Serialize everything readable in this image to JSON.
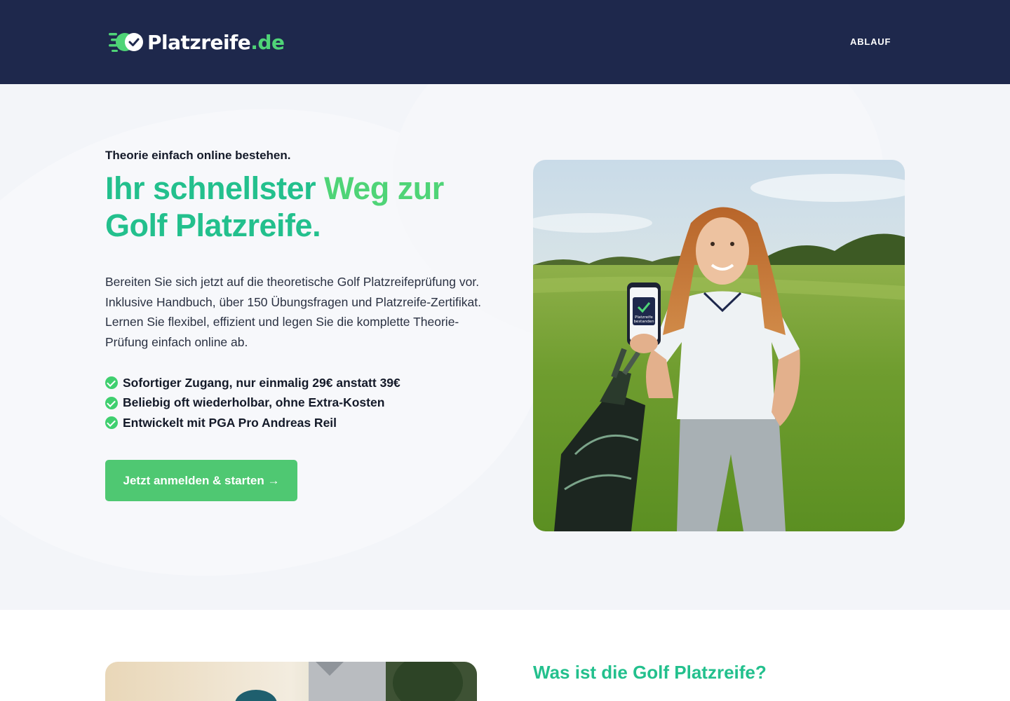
{
  "header": {
    "logo": {
      "name": "Platzreife",
      "tld": ".de"
    },
    "nav": [
      {
        "label": "ABLAUF"
      }
    ]
  },
  "hero": {
    "eyebrow": "Theorie einfach online bestehen.",
    "headline_part1": "Ihr schnellster ",
    "headline_part2": "Weg zur",
    "headline_part3": "Golf Platzreife.",
    "intro": "Bereiten Sie sich jetzt auf die theoretische Golf Platzreifeprüfung vor. Inklusive Handbuch, über 150 Übungsfragen und Platzreife-Zertifikat. Lernen Sie flexibel, effizient und legen Sie die komplette Theorie-Prüfung einfach online ab.",
    "features": [
      "Sofortiger Zugang, nur einmalig 29€ anstatt 39€",
      "Beliebig oft wiederholbar, ohne Extra-Kosten",
      "Entwickelt mit PGA Pro Andreas Reil"
    ],
    "cta_label": "Jetzt anmelden & starten →",
    "photo": {
      "phone_screen_text": [
        "Platzreife",
        "bestanden"
      ]
    }
  },
  "section2": {
    "title": "Was ist die Golf Platzreife?"
  },
  "colors": {
    "header_bg": "#1e284c",
    "brand_green": "#4fd477",
    "brand_teal": "#23c08d",
    "cta_bg": "#4fc872",
    "hero_bg": "#f3f5f9"
  },
  "icons": [
    "logo-check-icon",
    "check-circle-icon",
    "arrow-right-icon"
  ]
}
